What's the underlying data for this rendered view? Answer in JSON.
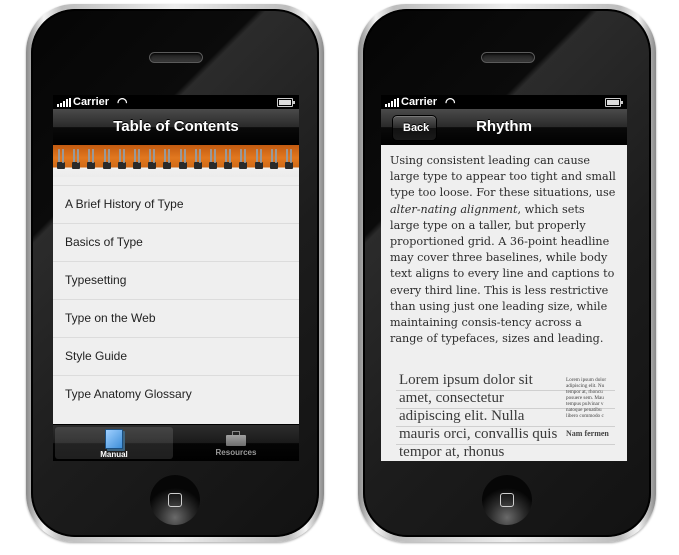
{
  "phones": {
    "left": {
      "status": {
        "carrier": "Carrier"
      },
      "nav": {
        "title": "Table of Contents"
      },
      "toc": [
        "A Brief History of Type",
        "Basics of Type",
        "Typesetting",
        "Type on the Web",
        "Style Guide",
        "Type Anatomy Glossary"
      ],
      "tabs": [
        {
          "label": "Manual",
          "icon": "book-icon",
          "active": true
        },
        {
          "label": "Resources",
          "icon": "toolbox-icon",
          "active": false
        }
      ]
    },
    "right": {
      "status": {
        "carrier": "Carrier"
      },
      "nav": {
        "title": "Rhythm",
        "back_label": "Back"
      },
      "article": {
        "text_before_em": "Using consistent leading can cause large type to appear too tight and small type too loose. For these situations, use ",
        "em": "alter-nating alignment",
        "text_after_em": ", which sets large type on a taller, but properly proportioned grid. A 36-point headline may cover three baselines, while body text aligns to every line and captions to every third line. This is less restrictive than using just one leading size, while maintaining consis-tency across a range of typefaces, sizes and leading."
      },
      "sample": {
        "large_text": "Lorem ipsum dolor sit amet, consectetur adipiscing elit. Nulla mauris orci, convallis quis tempor at, rhonus",
        "small_lines": [
          "Lorem ipsum dolor",
          "adipiscing elit. Nu",
          "tempor at, rhoncu",
          "posuere sem. Mau",
          "tempus pulvinar v",
          "natoque penatibu",
          "libero commodo c"
        ],
        "small_heading": "Nam fermen"
      }
    }
  },
  "colors": {
    "spiral_orange": "#e2781f",
    "list_bg": "#efefef",
    "manual_icon_blue": "#3e8ed8"
  }
}
